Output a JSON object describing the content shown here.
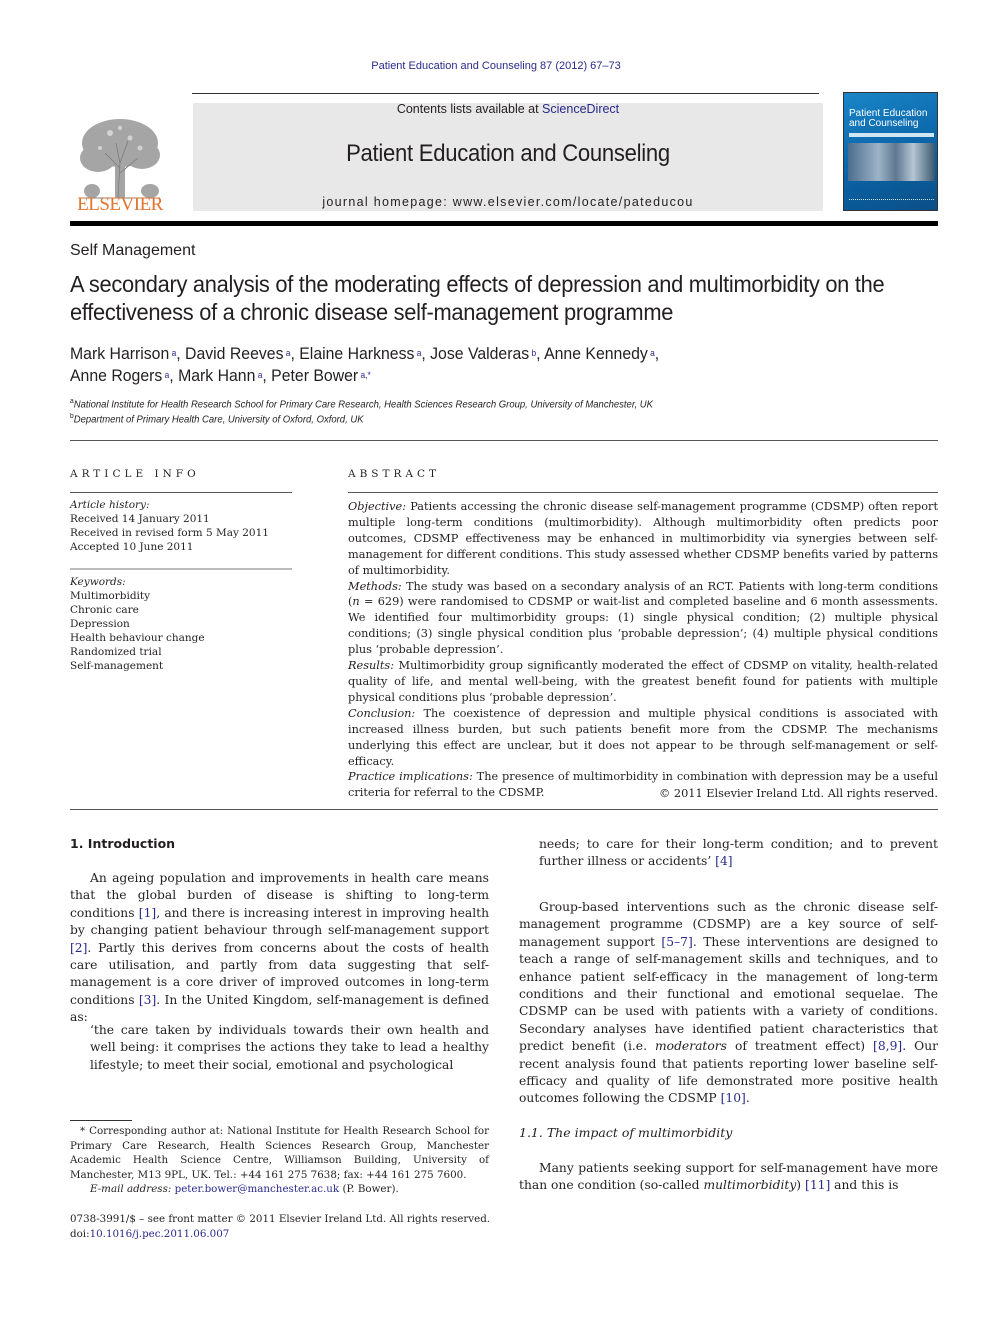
{
  "header": {
    "journal_ref": "Patient Education and Counseling 87 (2012) 67–73",
    "contents_prefix": "Contents lists available at ",
    "contents_link": "ScienceDirect",
    "journal_title": "Patient Education and Counseling",
    "homepage": "journal homepage: www.elsevier.com/locate/pateducou",
    "publisher_logo_text": "ELSEVIER",
    "cover_title_line1": "Patient Education",
    "cover_title_line2": "and Counseling"
  },
  "article": {
    "section": "Self Management",
    "title": "A secondary analysis of the moderating effects of depression and multimorbidity on the effectiveness of a chronic disease self-management programme",
    "authors_line1": [
      {
        "name": "Mark Harrison",
        "sup": "a",
        "sep": ", "
      },
      {
        "name": "David Reeves",
        "sup": "a",
        "sep": ", "
      },
      {
        "name": "Elaine Harkness",
        "sup": "a",
        "sep": ", "
      },
      {
        "name": "Jose Valderas",
        "sup": "b",
        "sep": ", "
      },
      {
        "name": "Anne Kennedy",
        "sup": "a",
        "sep": ","
      }
    ],
    "authors_line2": [
      {
        "name": "Anne Rogers",
        "sup": "a",
        "sep": ", "
      },
      {
        "name": "Mark Hann",
        "sup": "a",
        "sep": ", "
      },
      {
        "name": "Peter Bower",
        "sup": "a,*",
        "sep": ""
      }
    ],
    "affiliations": [
      {
        "sup": "a",
        "text": "National Institute for Health Research School for Primary Care Research, Health Sciences Research Group, University of Manchester, UK"
      },
      {
        "sup": "b",
        "text": "Department of Primary Health Care, University of Oxford, Oxford, UK"
      }
    ]
  },
  "article_info": {
    "heading": "ARTICLE INFO",
    "history_label": "Article history:",
    "history": [
      "Received 14 January 2011",
      "Received in revised form 5 May 2011",
      "Accepted 10 June 2011"
    ],
    "keywords_label": "Keywords:",
    "keywords": [
      "Multimorbidity",
      "Chronic care",
      "Depression",
      "Health behaviour change",
      "Randomized trial",
      "Self-management"
    ]
  },
  "abstract": {
    "heading": "ABSTRACT",
    "objective_label": "Objective:",
    "objective": " Patients accessing the chronic disease self-management programme (CDSMP) often report multiple long-term conditions (multimorbidity). Although multimorbidity often predicts poor outcomes, CDSMP effectiveness may be enhanced in multimorbidity via synergies between self-management for different conditions. This study assessed whether CDSMP benefits varied by patterns of multimorbidity.",
    "methods_label": "Methods:",
    "methods_a": " The study was based on a secondary analysis of an RCT. Patients with long-term conditions (",
    "methods_n": "n",
    "methods_b": " = 629) were randomised to CDSMP or wait-list and completed baseline and 6 month assessments. We identified four multimorbidity groups: (1) single physical condition; (2) multiple physical conditions; (3) single physical condition plus ‘probable depression’; (4) multiple physical conditions plus ‘probable depression’.",
    "results_label": "Results:",
    "results": " Multimorbidity group significantly moderated the effect of CDSMP on vitality, health-related quality of life, and mental well-being, with the greatest benefit found for patients with multiple physical conditions plus ‘probable depression’.",
    "conclusion_label": "Conclusion:",
    "conclusion": " The coexistence of depression and multiple physical conditions is associated with increased illness burden, but such patients benefit more from the CDSMP. The mechanisms underlying this effect are unclear, but it does not appear to be through self-management or self-efficacy.",
    "practice_label": "Practice implications:",
    "practice": " The presence of multimorbidity in combination with depression may be a useful criteria for referral to the CDSMP.",
    "copyright": "© 2011 Elsevier Ireland Ltd. All rights reserved."
  },
  "body": {
    "intro_heading": "1.  Introduction",
    "p1_a": "An ageing population and improvements in health care means that the global burden of disease is shifting to long-term conditions ",
    "p1_ref1": "[1]",
    "p1_b": ", and there is increasing interest in improving health by changing patient behaviour through self-management support ",
    "p1_ref2": "[2]",
    "p1_c": ". Partly this derives from concerns about the costs of health care utilisation, and partly from data suggesting that self-management is a core driver of improved outcomes in long-term conditions ",
    "p1_ref3": "[3]",
    "p1_d": ". In the United Kingdom, self-management is defined as:",
    "quote_a": "‘the care taken by individuals towards their own health and well being: it comprises the actions they take to lead a healthy lifestyle; to meet their social, emotional and psychological",
    "quote_b": "needs; to care for their long-term condition; and to prevent further illness or accidents’ ",
    "quote_ref": "[4]",
    "p2_a": "Group-based interventions such as the chronic disease self-management programme (CDSMP) are a key source of self-management support ",
    "p2_ref1": "[5–7]",
    "p2_b": ". These interventions are designed to teach a range of self-management skills and techniques, and to enhance patient self-efficacy in the management of long-term conditions and their functional and emotional sequelae. The CDSMP can be used with patients with a variety of conditions. Secondary analyses have identified patient characteristics that predict benefit (i.e. ",
    "p2_em": "moderators",
    "p2_c": " of treatment effect) ",
    "p2_ref2": "[8,9]",
    "p2_d": ". Our recent analysis found that patients reporting lower baseline self-efficacy and quality of life demonstrated more positive health outcomes following the CDSMP ",
    "p2_ref3": "[10]",
    "p2_e": ".",
    "sub_heading": "1.1.  The impact of multimorbidity",
    "p3_a": "Many patients seeking support for self-management have more than one condition (so-called ",
    "p3_em": "multimorbidity",
    "p3_b": ") ",
    "p3_ref": "[11]",
    "p3_c": " and this is"
  },
  "footnotes": {
    "corresponding": "* Corresponding author at: National Institute for Health Research School for Primary Care Research, Health Sciences Research Group, Manchester Academic Health Science Centre, Williamson Building, University of Manchester, M13 9PL, UK. Tel.: +44 161 275 7638; fax: +44 161 275 7600.",
    "email_label": "E-mail address:",
    "email": "peter.bower@manchester.ac.uk",
    "email_suffix": " (P. Bower).",
    "issn": "0738-3991/$ – see front matter © 2011 Elsevier Ireland Ltd. All rights reserved.",
    "doi_prefix": "doi:",
    "doi": "10.1016/j.pec.2011.06.007"
  }
}
